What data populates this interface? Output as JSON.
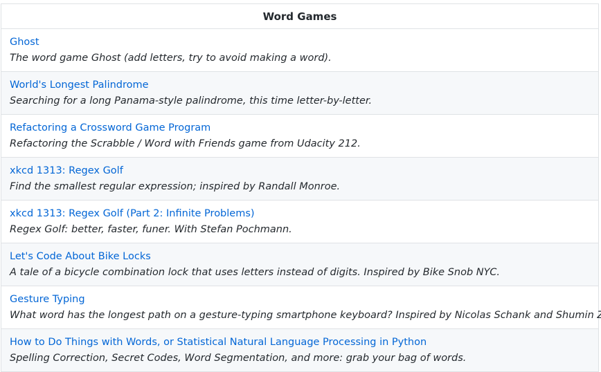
{
  "table": {
    "header": "Word Games",
    "rows": [
      {
        "title": "Ghost",
        "description": "The word game Ghost (add letters, try to avoid making a word)."
      },
      {
        "title": "World's Longest Palindrome",
        "description": "Searching for a long Panama-style palindrome, this time letter-by-letter."
      },
      {
        "title": "Refactoring a Crossword Game Program",
        "description": "Refactoring the Scrabble / Word with Friends game from Udacity 212."
      },
      {
        "title": "xkcd 1313: Regex Golf",
        "description": "Find the smallest regular expression; inspired by Randall Monroe."
      },
      {
        "title": "xkcd 1313: Regex Golf (Part 2: Infinite Problems)",
        "description": "Regex Golf: better, faster, funer. With Stefan Pochmann."
      },
      {
        "title": "Let's Code About Bike Locks",
        "description": "A tale of a bicycle combination lock that uses letters instead of digits. Inspired by Bike Snob NYC."
      },
      {
        "title": "Gesture Typing",
        "description": "What word has the longest path on a gesture-typing smartphone keyboard? Inspired by Nicolas Schank and Shumin Zhai."
      },
      {
        "title": "How to Do Things with Words, or Statistical Natural Language Processing in Python",
        "description": "Spelling Correction, Secret Codes, Word Segmentation, and more: grab your bag of words."
      }
    ]
  },
  "colors": {
    "link": "#0366d6",
    "border": "#dfe2e5",
    "alt_row_bg": "#f6f8fa",
    "text": "#24292e"
  }
}
